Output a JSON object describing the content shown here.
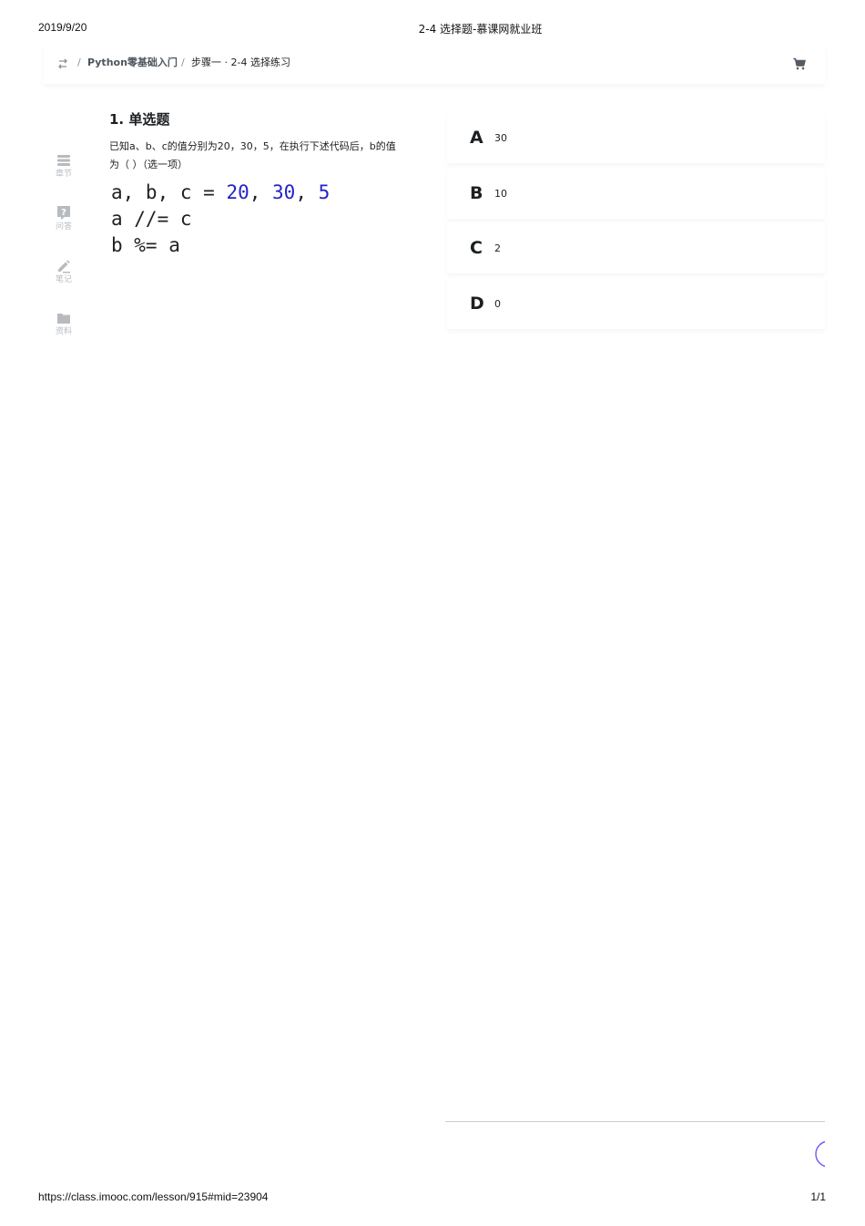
{
  "print_header": {
    "date": "2019/9/20",
    "title": "2-4 选择题-慕课网就业班"
  },
  "print_footer": {
    "url": "https://class.imooc.com/lesson/915#mid=23904",
    "page": "1/1"
  },
  "breadcrumb": {
    "sep": "/",
    "course": "Python零基础入门",
    "step": "步骤一 · 2-4 选择练习"
  },
  "side_nav": [
    {
      "label": "章节",
      "icon": "chapter-icon"
    },
    {
      "label": "问答",
      "icon": "question-icon"
    },
    {
      "label": "笔记",
      "icon": "note-pencil-icon"
    },
    {
      "label": "资料",
      "icon": "folder-icon"
    }
  ],
  "question": {
    "title": "1. 单选题",
    "description": "已知a、b、c的值分别为20，30，5，在执行下述代码后，b的值为（ ）（选一项）",
    "code": {
      "line1_prefix": "a, b, c = ",
      "n1": "20",
      "comma1": ", ",
      "n2": "30",
      "comma2": ", ",
      "n3": "5",
      "line2": "a //= c",
      "line3": "b %= a"
    }
  },
  "options": [
    {
      "letter": "A",
      "text": "30"
    },
    {
      "letter": "B",
      "text": "10"
    },
    {
      "letter": "C",
      "text": "2"
    },
    {
      "letter": "D",
      "text": "0"
    }
  ],
  "colors": {
    "accent_purple": "#7b5cff",
    "code_number": "#2323c8",
    "side_icon": "#b7bbbf"
  }
}
